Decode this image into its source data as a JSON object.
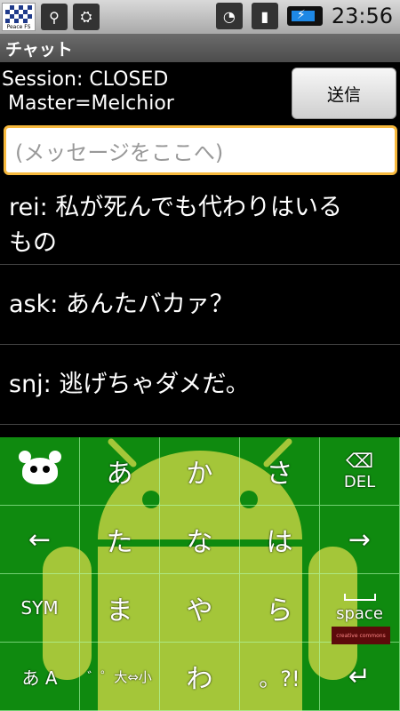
{
  "status_bar": {
    "app_icon_text": "Peace FS",
    "time": "23:56",
    "icons": [
      "usb-icon",
      "android-debug-icon",
      "wifi-icon",
      "signal-icon",
      "battery-charging-icon"
    ]
  },
  "title_bar": {
    "title": "チャット"
  },
  "session": {
    "status_line": "Session: CLOSED",
    "master_line": " Master=Melchior",
    "send_label": "送信"
  },
  "input": {
    "placeholder": "(メッセージをここへ)"
  },
  "messages": [
    {
      "line1": "rei: 私が死んでも代わりはいる",
      "line2": "もの"
    },
    {
      "line1": "ask: あんたバカァ？"
    },
    {
      "line1": "snj: 逃げちゃダメだ。"
    }
  ],
  "keyboard": {
    "rows": [
      [
        "",
        "あ",
        "か",
        "さ",
        "DEL"
      ],
      [
        "←",
        "た",
        "な",
        "は",
        "→"
      ],
      [
        "SYM",
        "ま",
        "や",
        "ら",
        "space"
      ],
      [
        "あ A",
        "゛゜大⇔小",
        "わ",
        "。?!",
        "↵"
      ]
    ],
    "brand_tag": "creative commons"
  },
  "colors": {
    "keyboard_bg": "#0f8a0f",
    "droid": "#a4c639",
    "input_border": "#f7b93d",
    "mode_hira": "#8cff6a"
  }
}
